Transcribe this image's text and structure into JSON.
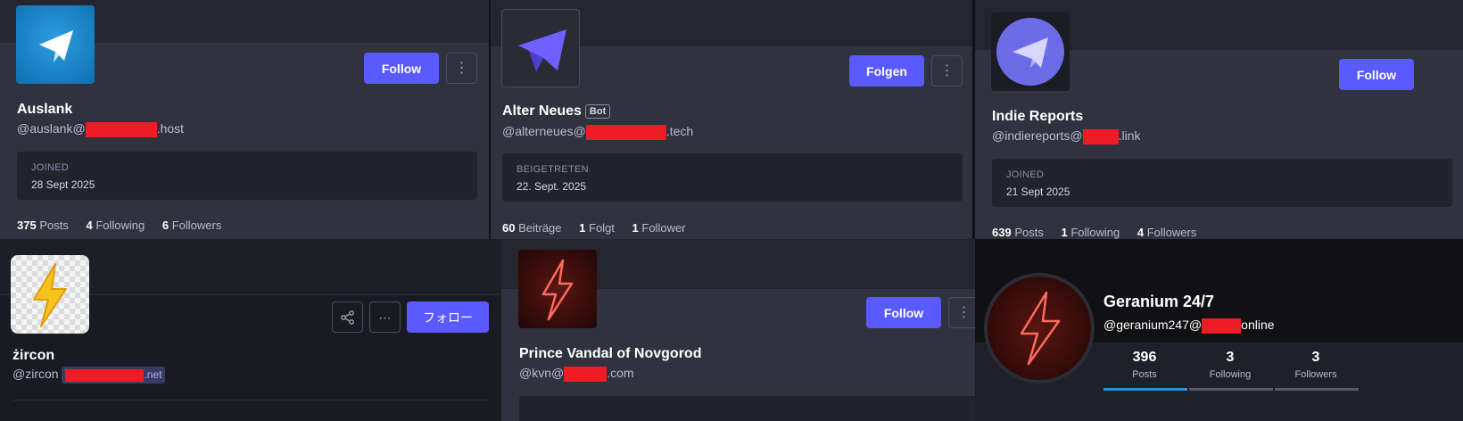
{
  "profiles": {
    "auslank": {
      "name": "Auslank",
      "handle_prefix": "@auslank@",
      "handle_suffix": ".host",
      "follow_label": "Follow",
      "joined_label": "JOINED",
      "joined_date": "28 Sept 2025",
      "posts_count": "375",
      "posts_label": "Posts",
      "following_count": "4",
      "following_label": "Following",
      "followers_count": "6",
      "followers_label": "Followers"
    },
    "alter_neues": {
      "name": "Alter Neues",
      "bot_badge": "Bot",
      "handle_prefix": "@alterneues@",
      "handle_suffix": ".tech",
      "follow_label": "Folgen",
      "joined_label": "BEIGETRETEN",
      "joined_date": "22. Sept. 2025",
      "posts_count": "60",
      "posts_label": "Beiträge",
      "following_count": "1",
      "following_label": "Folgt",
      "followers_count": "1",
      "followers_label": "Follower"
    },
    "indie_reports": {
      "name": "Indie Reports",
      "handle_prefix": "@indiereports@",
      "handle_suffix": ".link",
      "follow_label": "Follow",
      "joined_label": "JOINED",
      "joined_date": "21 Sept 2025",
      "posts_count": "639",
      "posts_label": "Posts",
      "following_count": "1",
      "following_label": "Following",
      "followers_count": "4",
      "followers_label": "Followers"
    },
    "zircon": {
      "name": "żircon",
      "handle_prefix": "@zircon",
      "domain_suffix": ".net",
      "follow_label": "フォロー"
    },
    "prince_vandal": {
      "name": "Prince Vandal of Novgorod",
      "handle_prefix": "@kvn@",
      "handle_suffix": ".com",
      "follow_label": "Follow"
    },
    "geranium": {
      "name": "Geranium 24/7",
      "handle_prefix": "@geranium247@",
      "handle_suffix": "online",
      "posts_count": "396",
      "posts_label": "Posts",
      "following_count": "3",
      "following_label": "Following",
      "followers_count": "3",
      "followers_label": "Followers"
    }
  },
  "icons": {
    "telegram": "paper-plane-icon",
    "lightning": "lightning-bolt-icon",
    "more": "vertical-ellipsis-icon",
    "share": "share-icon"
  },
  "colors": {
    "accent": "#595aff",
    "redaction": "#ee1c25",
    "page_bg": "#1f2029",
    "card_bg": "#30323f"
  }
}
